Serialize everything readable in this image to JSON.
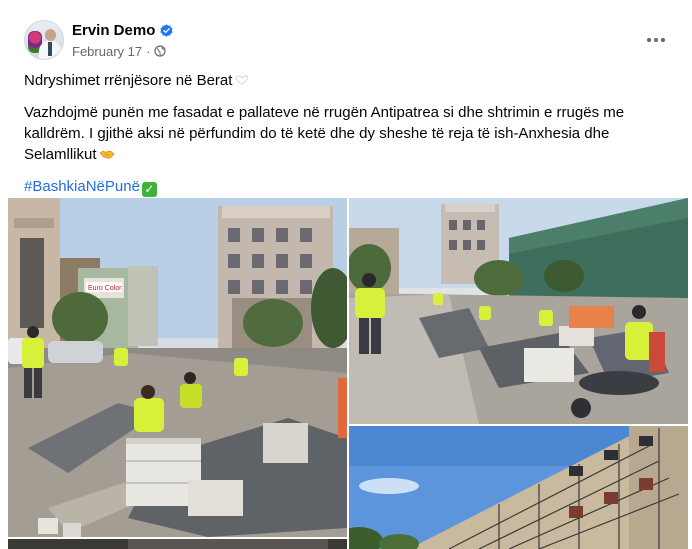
{
  "post": {
    "author": "Ervin Demo",
    "date": "February 17",
    "separator": "·",
    "privacy_icon": "globe-icon",
    "verified_icon": "verified-badge-icon",
    "more_icon": "more-options-icon"
  },
  "content": {
    "title": "Ndryshimet rrënjësore në Berat",
    "body": "Vazhdojmë punën me fasadat e pallateve në rrugën Antipatrea si dhe shtrimin e rrugës me kalldrëm. I gjithë aksi në përfundim do të ketë dhe dy sheshe të reja të ish-Anxhesia dhe Selamllikut",
    "hashtag": "#BashkiaNëPunë",
    "emoji_title": "white-heart",
    "emoji_body": "handshake",
    "emoji_hashtag": "check-mark"
  },
  "photos": [
    {
      "name": "street-paving-workers-photo",
      "sign": "Euro Color"
    },
    {
      "name": "cobblestone-laying-photo",
      "sign": ""
    },
    {
      "name": "building-facade-scaffolding-photo",
      "sign": ""
    },
    {
      "name": "additional-photo",
      "sign": ""
    }
  ],
  "colors": {
    "text": "#050505",
    "secondary": "#65676b",
    "link": "#216fdb",
    "verified": "#1877f2",
    "vest": "#d7f03a"
  }
}
